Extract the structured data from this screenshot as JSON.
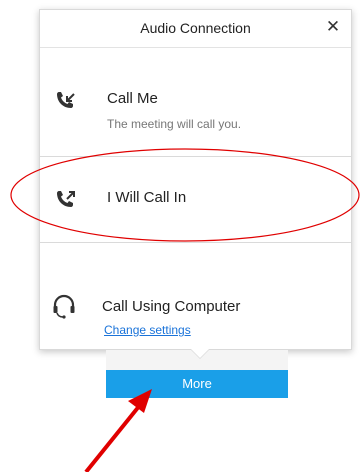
{
  "dialog": {
    "title": "Audio Connection",
    "close_glyph": "✕"
  },
  "options": [
    {
      "label": "Call Me",
      "subtitle": "The meeting will call you.",
      "icon": "phone-incoming-icon"
    },
    {
      "label": "I Will Call In",
      "icon": "phone-outgoing-icon"
    },
    {
      "label": "Call Using Computer",
      "link": "Change settings",
      "icon": "headset-icon"
    }
  ],
  "more_button": {
    "label": "More"
  },
  "colors": {
    "accent": "#1a9fe8",
    "link": "#1a73d9",
    "annotation": "#e00000"
  }
}
